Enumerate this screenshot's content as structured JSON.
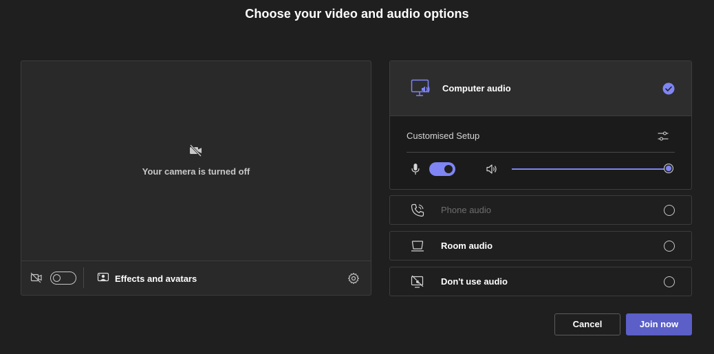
{
  "page": {
    "title": "Choose your video and audio options"
  },
  "video": {
    "status_text": "Your camera is turned off",
    "camera_toggle": "off",
    "effects_label": "Effects and avatars",
    "icons": [
      "camera-off-icon",
      "effects-icon",
      "gear-icon"
    ]
  },
  "audio": {
    "computer_audio": {
      "label": "Computer audio",
      "selected": true,
      "icon": "monitor-speaker-icon"
    },
    "custom_setup_label": "Customised Setup",
    "mic_toggle": "on",
    "speaker_volume": 1.0,
    "options": [
      {
        "label": "Phone audio",
        "icon": "phone-icon",
        "enabled": false,
        "selected": false
      },
      {
        "label": "Room audio",
        "icon": "room-device-icon",
        "enabled": true,
        "selected": false
      },
      {
        "label": "Don't use audio",
        "icon": "no-audio-icon",
        "enabled": true,
        "selected": false
      }
    ]
  },
  "buttons": {
    "cancel": "Cancel",
    "join": "Join now"
  },
  "colors": {
    "accent": "#7f85f5",
    "primary_button": "#5b5fc7",
    "background": "#1f1f1f",
    "panel": "#292929"
  }
}
